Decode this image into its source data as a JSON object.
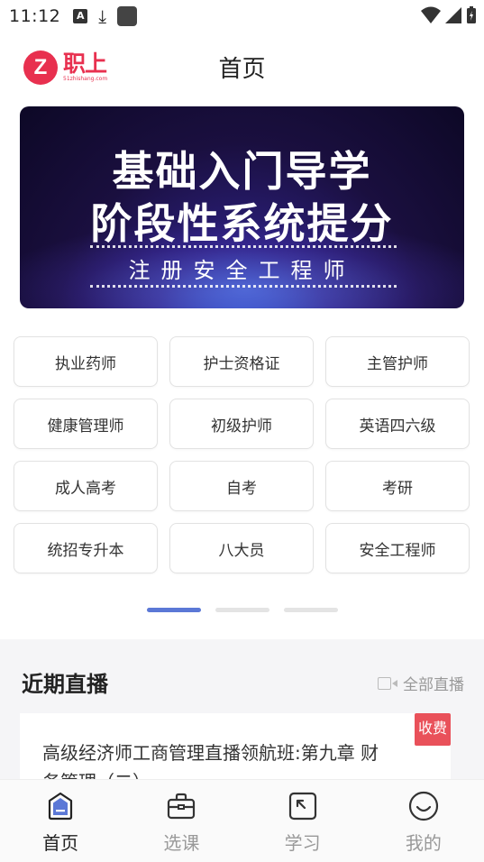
{
  "status_bar": {
    "time": "11:12",
    "icon_a": "A"
  },
  "header": {
    "logo_icon": "Z",
    "logo_main": "职上",
    "logo_sub": "51zhishang.com",
    "title": "首页"
  },
  "banner": {
    "line1": "基础入门导学",
    "line2": "阶段性系统提分",
    "line3": "注册安全工程师"
  },
  "categories": [
    "执业药师",
    "护士资格证",
    "主管护师",
    "健康管理师",
    "初级护师",
    "英语四六级",
    "成人高考",
    "自考",
    "考研",
    "统招专升本",
    "八大员",
    "安全工程师"
  ],
  "pager": {
    "pages": 3,
    "active": 0
  },
  "live": {
    "title": "近期直播",
    "all_label": "全部直播",
    "card_title": "高级经济师工商管理直播领航班:第九章 财务管理（二）",
    "badge": "收费"
  },
  "nav": [
    {
      "label": "首页",
      "icon": "home-icon"
    },
    {
      "label": "选课",
      "icon": "bag-icon"
    },
    {
      "label": "学习",
      "icon": "study-icon"
    },
    {
      "label": "我的",
      "icon": "profile-icon"
    }
  ],
  "colors": {
    "brand": "#e8304f",
    "accent": "#5b78d6",
    "badge": "#e9515a"
  }
}
